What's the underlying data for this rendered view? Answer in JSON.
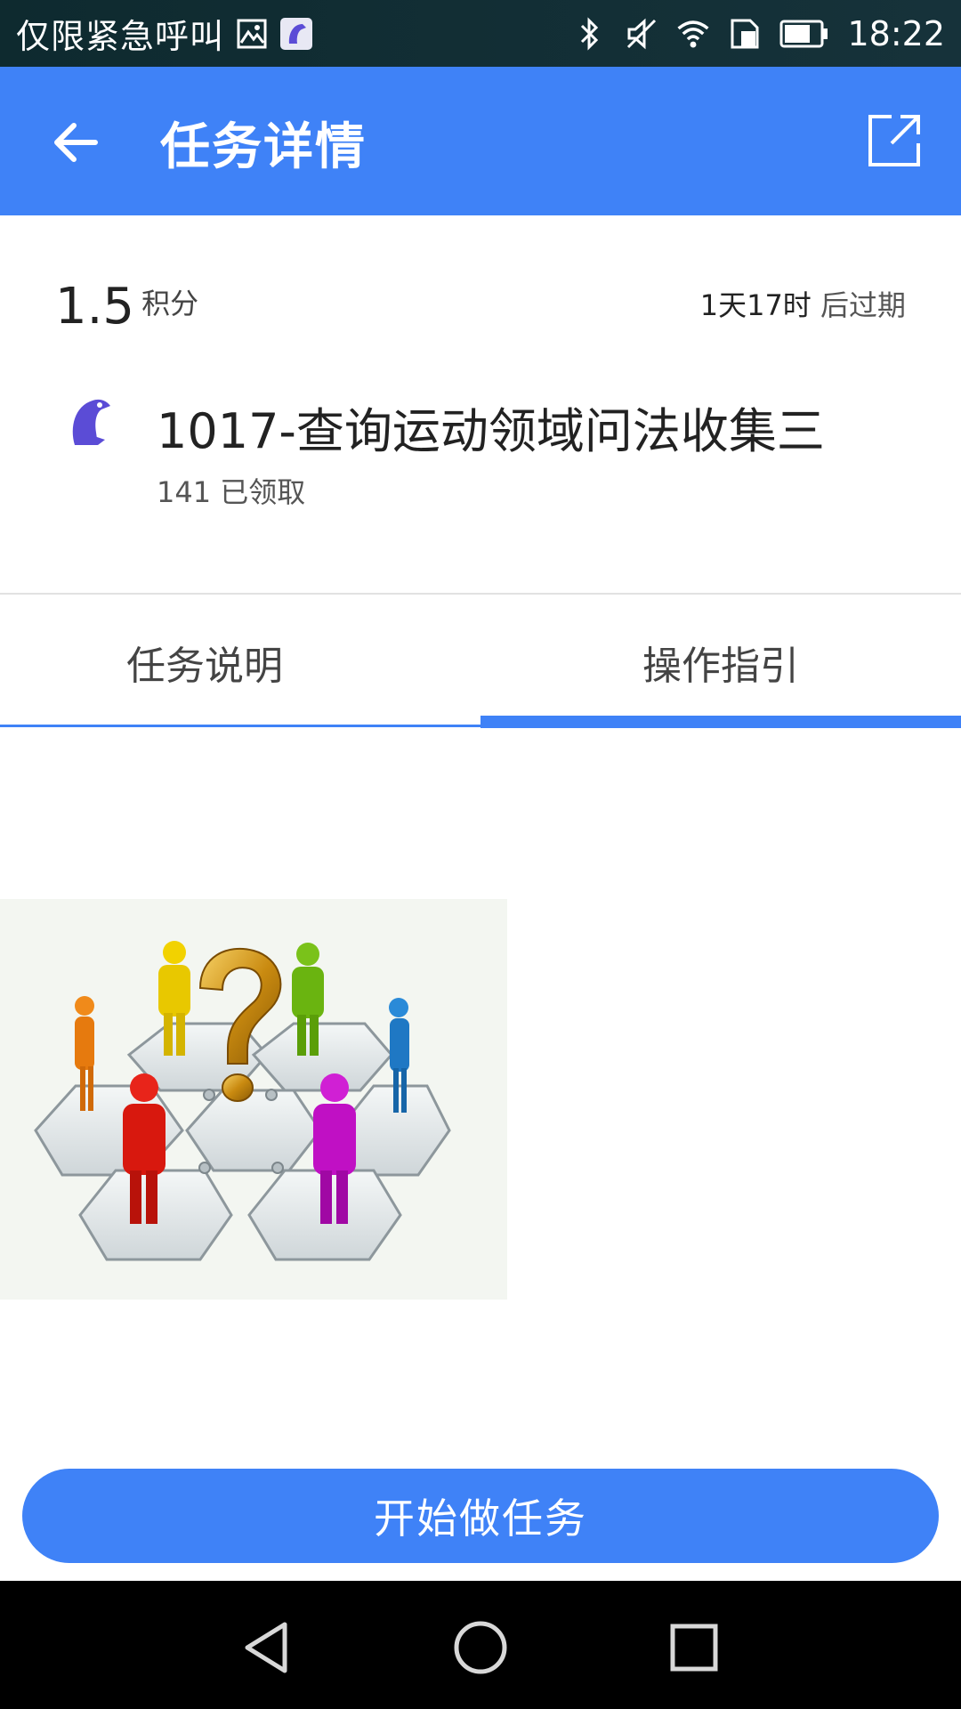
{
  "status_bar": {
    "carrier_text": "仅限紧急呼叫",
    "time": "18:22",
    "icons": [
      "image-icon",
      "app-logo-icon",
      "bluetooth-icon",
      "mute-icon",
      "wifi-icon",
      "sim-icon",
      "battery-icon"
    ]
  },
  "app_bar": {
    "title": "任务详情",
    "back_icon": "arrow-left-icon",
    "share_icon": "external-link-icon"
  },
  "task": {
    "points_value": "1.5",
    "points_unit": "积分",
    "expiry_time": "1天17时",
    "expiry_suffix": "后过期",
    "title": "1017-查询运动领域问法收集三",
    "claimed": "141 已领取"
  },
  "tabs": [
    {
      "label": "任务说明",
      "active": false
    },
    {
      "label": "操作指引",
      "active": true
    }
  ],
  "illustration": {
    "figures": [
      "orange",
      "yellow",
      "green",
      "blue",
      "red",
      "magenta"
    ],
    "symbol": "?"
  },
  "actions": {
    "start_label": "开始做任务"
  },
  "nav_bar": {
    "buttons": [
      "back-triangle-icon",
      "home-circle-icon",
      "recents-square-icon"
    ]
  },
  "colors": {
    "primary": "#3f82f7",
    "status_bar": "#0e2a2f",
    "nav_bar": "#000000"
  }
}
